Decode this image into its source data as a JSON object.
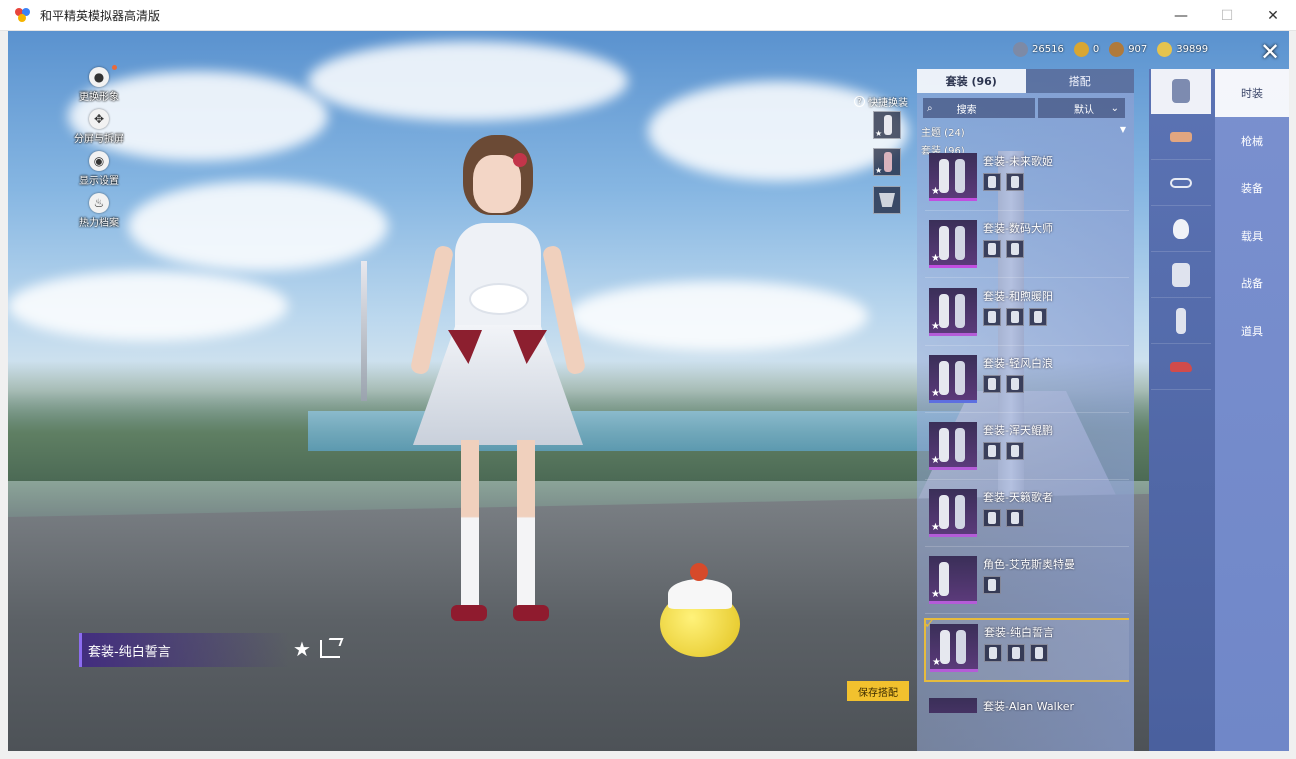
{
  "window": {
    "title": "和平精英模拟器高清版",
    "minimize": "—",
    "maximize": "☐",
    "close": "✕"
  },
  "left_menu": [
    {
      "label": "更换形象",
      "icon": "person-icon"
    },
    {
      "label": "分屏与拆屏",
      "icon": "split-icon"
    },
    {
      "label": "显示设置",
      "icon": "eye-icon"
    },
    {
      "label": "热力档案",
      "icon": "flame-icon"
    }
  ],
  "currency": [
    {
      "value": "26516",
      "color": "#7d8aa6",
      "icon": "globe-coin-icon"
    },
    {
      "value": "0",
      "color": "#d9a632",
      "icon": "gold-medal-icon"
    },
    {
      "value": "907",
      "color": "#b07a3b",
      "icon": "bronze-coin-icon"
    },
    {
      "value": "39899",
      "color": "#e5c34e",
      "icon": "diamond-coin-icon"
    }
  ],
  "close_label": "✕",
  "quick_swap": {
    "label": "快捷换装",
    "help": "?"
  },
  "panel": {
    "tabs": [
      {
        "label": "套装 (96)"
      },
      {
        "label": "搭配"
      }
    ],
    "search_label": "搜索",
    "sort_label": "默认",
    "theme_line": "主题 (24)",
    "suit_line": "套装 (96)",
    "outfits": [
      {
        "name": "套装-未来歌姬",
        "parts": 2
      },
      {
        "name": "套装-数码大师",
        "parts": 2
      },
      {
        "name": "套装-和煦暖阳",
        "parts": 3
      },
      {
        "name": "套装-轻风白浪",
        "parts": 2
      },
      {
        "name": "套装-浑天鲲鹏",
        "parts": 2
      },
      {
        "name": "套装-天籁歌者",
        "parts": 2
      },
      {
        "name": "角色-艾克斯奥特曼",
        "parts": 1
      },
      {
        "name": "套装-纯白誓言",
        "parts": 3,
        "selected": true
      },
      {
        "name": "套装-Alan Walker",
        "parts": 0
      }
    ],
    "save_label": "保存搭配"
  },
  "categories": [
    {
      "label": "时装",
      "icon": "outfit-icon",
      "active": true
    },
    {
      "label": "枪械",
      "icon": "gun-icon"
    },
    {
      "label": "装备",
      "icon": "glasses-icon"
    },
    {
      "label": "载具",
      "icon": "mask-icon"
    },
    {
      "label": "战备",
      "icon": "armor-icon"
    },
    {
      "label": "道具",
      "icon": "pants-icon"
    }
  ],
  "selected_outfit": {
    "name": "套装-纯白誓言"
  },
  "accent": "#e6bb3d"
}
